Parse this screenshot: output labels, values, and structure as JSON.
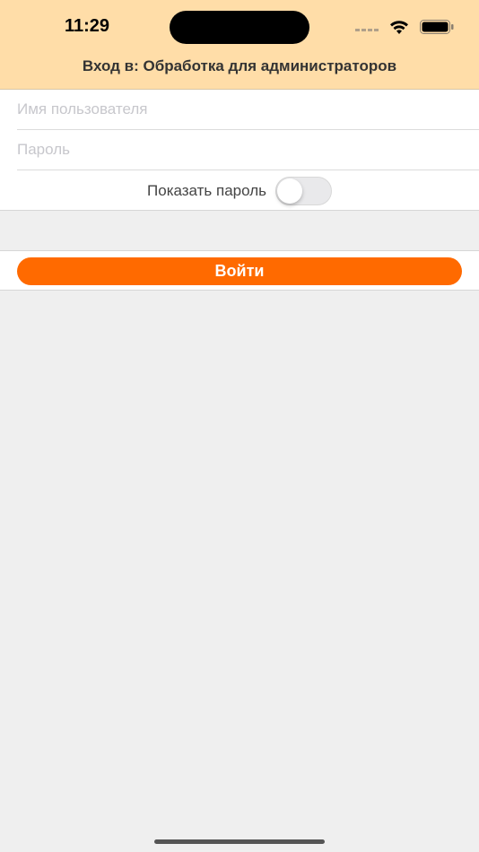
{
  "status_bar": {
    "time": "11:29"
  },
  "header": {
    "title": "Вход в: Обработка для администраторов"
  },
  "form": {
    "username_placeholder": "Имя пользователя",
    "username_value": "",
    "password_placeholder": "Пароль",
    "password_value": "",
    "show_password_label": "Показать пароль",
    "show_password_on": false
  },
  "actions": {
    "login_label": "Войти"
  },
  "colors": {
    "header_bg": "#ffdda8",
    "accent": "#ff6a00",
    "page_bg": "#efefef"
  },
  "icons": [
    "signal-icon",
    "wifi-icon",
    "battery-icon"
  ]
}
